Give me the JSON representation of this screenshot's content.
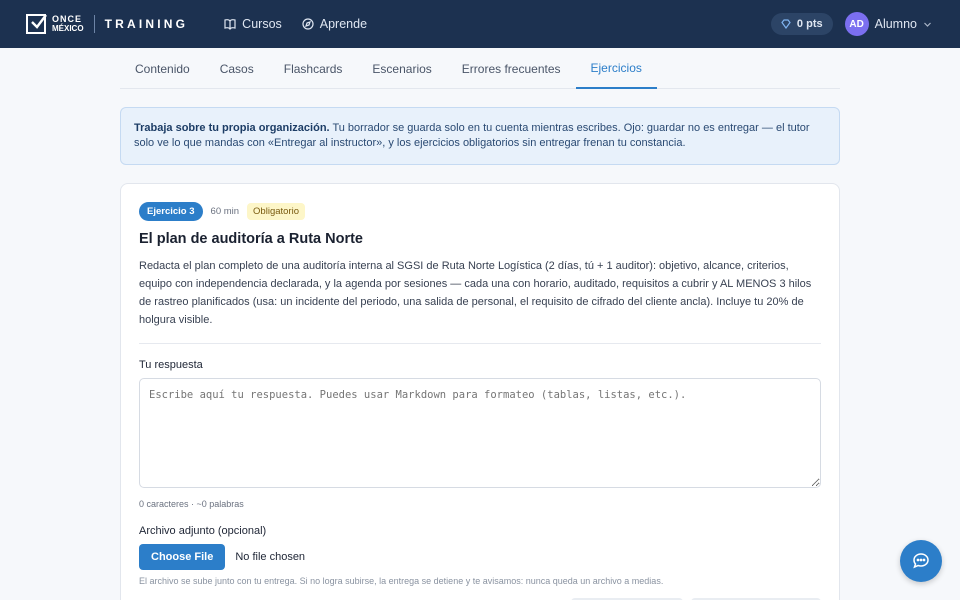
{
  "header": {
    "logo_line1": "ONCE",
    "logo_line2": "MÉXICO",
    "app_name": "TRAINING",
    "nav": [
      {
        "label": "Cursos",
        "icon": "book-icon"
      },
      {
        "label": "Aprende",
        "icon": "compass-icon"
      }
    ],
    "points": "0 pts",
    "avatar_initials": "AD",
    "user_name": "Alumno"
  },
  "tabs": [
    "Contenido",
    "Casos",
    "Flashcards",
    "Escenarios",
    "Errores frecuentes",
    "Ejercicios"
  ],
  "active_tab": "Ejercicios",
  "notice": {
    "bold": "Trabaja sobre tu propia organización.",
    "text": " Tu borrador se guarda solo en tu cuenta mientras escribes. Ojo: guardar no es entregar — el tutor solo ve lo que mandas con «Entregar al instructor», y los ejercicios obligatorios sin entregar frenan tu constancia."
  },
  "exercise": {
    "badge": "Ejercicio 3",
    "duration": "60 min",
    "required": "Obligatorio",
    "title": "El plan de auditoría a Ruta Norte",
    "description": "Redacta el plan completo de una auditoría interna al SGSI de Ruta Norte Logística (2 días, tú + 1 auditor): objetivo, alcance, criterios, equipo con independencia declarada, y la agenda por sesiones — cada una con horario, auditado, requisitos a cubrir y AL MENOS 3 hilos de rastreo planificados (usa: un incidente del periodo, una salida de personal, el requisito de cifrado del cliente ancla). Incluye tu 20% de holgura visible."
  },
  "answer": {
    "label": "Tu respuesta",
    "placeholder": "Escribe aquí tu respuesta. Puedes usar Markdown para formateo (tablas, listas, etc.).",
    "value": "",
    "counts": "0 caracteres · ~0 palabras"
  },
  "attachment": {
    "label": "Archivo adjunto (opcional)",
    "button": "Choose File",
    "status": "No file chosen",
    "help": "El archivo se sube junto con tu entrega. Si no logra subirse, la entrega se detiene y te avisamos: nunca queda un archivo a medias."
  },
  "colors": {
    "header_bg": "#1c3150",
    "accent": "#2c7ec9",
    "avatar": "#7b6ff0"
  }
}
